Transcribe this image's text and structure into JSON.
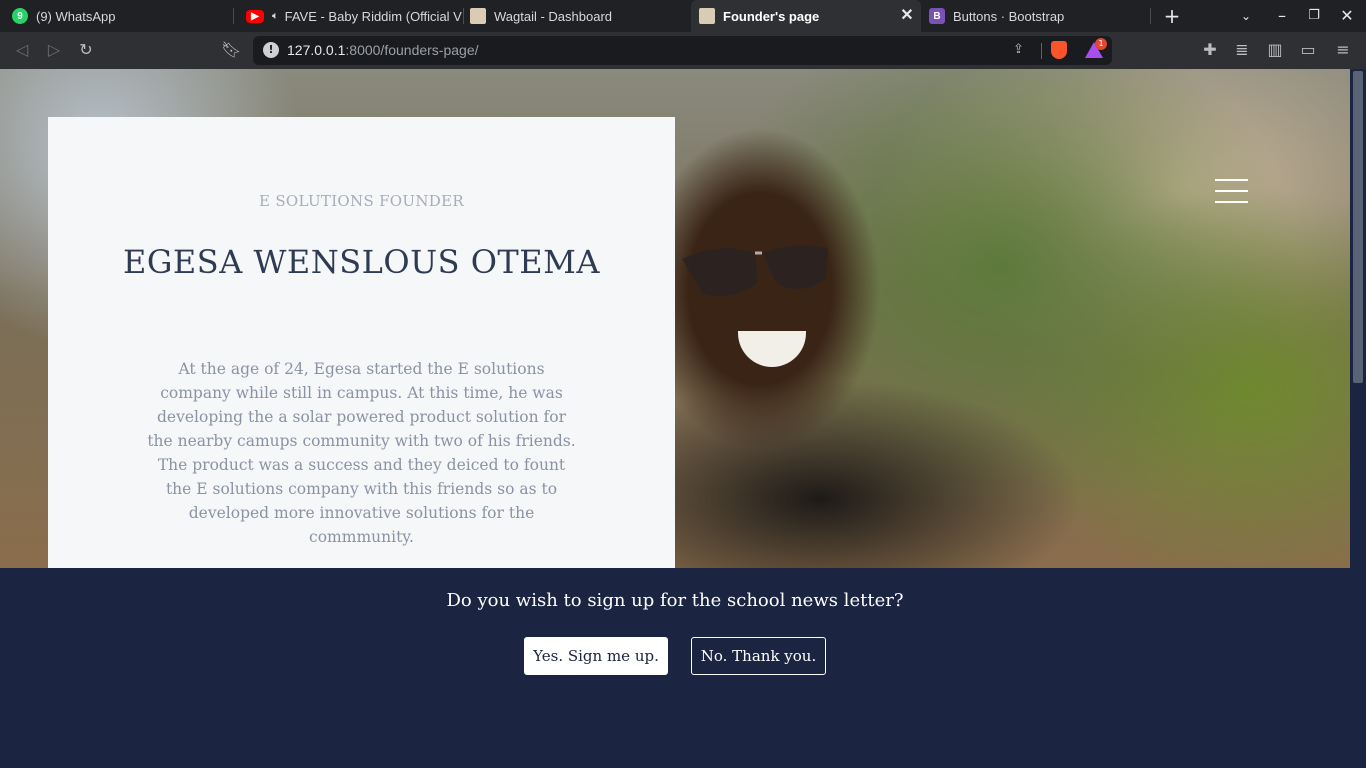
{
  "browser": {
    "tabs": [
      {
        "label": "(9) WhatsApp",
        "icon": "whatsapp-icon",
        "color": "#25d366"
      },
      {
        "label": "FAVE - Baby Riddim (Official V",
        "icon": "youtube-icon",
        "color": "#ff0000"
      },
      {
        "label": "Wagtail - Dashboard",
        "icon": "wagtail-icon",
        "color": "#43b1b0"
      },
      {
        "label": "Founder's page",
        "icon": "wagtail-icon",
        "color": "#43b1b0",
        "active": true
      },
      {
        "label": "Buttons · Bootstrap",
        "icon": "bootstrap-icon",
        "color": "#7952b3"
      }
    ],
    "whatsapp_badge": "9",
    "bootstrap_letter": "B",
    "url_host": "127.0.0.1",
    "url_rest": ":8000/founders-page/",
    "rewards_badge": "1"
  },
  "hero": {
    "eyebrow": "E SOLUTIONS FOUNDER",
    "name": "EGESA WENSLOUS OTEMA",
    "bio": "At the age of 24, Egesa started the E solutions company while still in campus. At this time, he was developing the a solar powered product solution for the nearby camups community with two of his friends. The product was a success and they deiced to fount the E solutions company with this friends so as to developed more innovative solutions for the commmunity."
  },
  "newsletter": {
    "question": "Do you wish to sign up for the school news letter?",
    "yes_label": "Yes. Sign me up.",
    "no_label": "No. Thank you."
  },
  "colors": {
    "navy": "#1b2440",
    "card": "#f6f7f9",
    "heading": "#2f3b52"
  }
}
